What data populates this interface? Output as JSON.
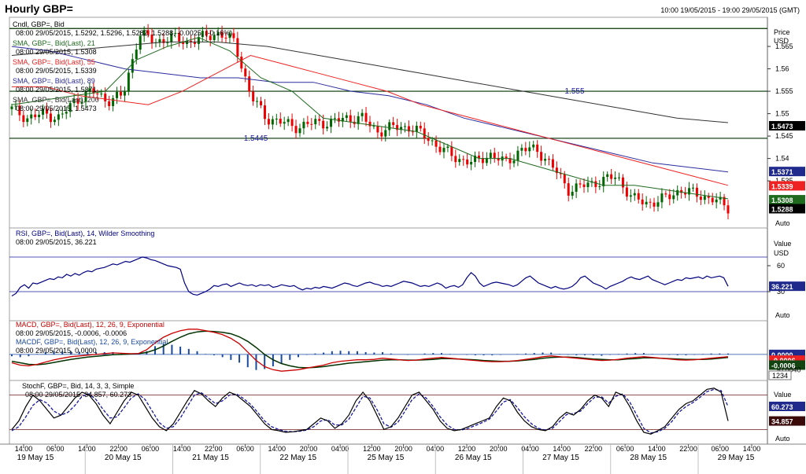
{
  "header": {
    "title": "Hourly GBP=",
    "range": "10:00 19/05/2015 - 19:00 29/05/2015 (GMT)"
  },
  "colors": {
    "up": "#006600",
    "down": "#ee0000",
    "sma21": "#1e6b1e",
    "sma55": "#ee2222",
    "sma89": "#2b2b9e",
    "sma200": "#333333",
    "level": "#003300",
    "rsi": "#000080",
    "macd": "#cc0000",
    "macdSignal": "#003300",
    "hist": "#1a4aa0",
    "stochK": "#000000",
    "stochD": "#1a1aa0",
    "stochRef": "#6b1a1a"
  },
  "xaxis": {
    "hours": [
      "14:00",
      "06:00",
      "14:00",
      "22:00",
      "06:00",
      "14:00",
      "22:00",
      "06:00",
      "14:00",
      "20:00",
      "04:00",
      "12:00",
      "20:00",
      "04:00",
      "12:00",
      "20:00",
      "04:00",
      "14:00",
      "22:00",
      "06:00",
      "14:00",
      "22:00",
      "06:00",
      "14:00"
    ],
    "days": [
      "19 May 15",
      "20 May 15",
      "21 May 15",
      "22 May 15",
      "25 May 15",
      "26 May 15",
      "27 May 15",
      "28 May 15",
      "29 May 15"
    ]
  },
  "chart_data": [
    {
      "type": "candlestick",
      "panel": "price",
      "ylim": [
        1.5245,
        1.5715
      ],
      "yticks": [
        "1.565",
        "1.56",
        "1.555",
        "1.55",
        "1.545",
        "1.54",
        "1.535"
      ],
      "ylabel": "Price",
      "unit": "USD",
      "auto_label": "Auto",
      "legend": [
        {
          "label": "Cndl, GBP=, Bid",
          "info": "08:00 29/05/2015, 1.5292, 1.5296, 1.5282, 1.5288, -0.0025, (-0.16%)",
          "color": "#000000"
        },
        {
          "label": "SMA, GBP=, Bid(Last), 21",
          "info": "08:00 29/05/2015, 1.5308",
          "color": "#1e6b1e"
        },
        {
          "label": "SMA, GBP=, Bid(Last), 55",
          "info": "08:00 29/05/2015, 1.5339",
          "color": "#ee2222"
        },
        {
          "label": "SMA, GBP=, Bid(Last), 89",
          "info": "08:00 29/05/2015, 1.5371",
          "color": "#2b2b9e"
        },
        {
          "label": "SMA, GBP=, Bid(Last), 200",
          "info": "08:00 29/05/2015, 1.5473",
          "color": "#333333"
        }
      ],
      "levels": [
        {
          "value": 1.569,
          "label": ""
        },
        {
          "value": 1.555,
          "label": "1.555"
        },
        {
          "value": 1.5445,
          "label": "1.5445"
        }
      ],
      "close_path": [
        1.551,
        1.549,
        1.55,
        1.549,
        1.553,
        1.555,
        1.553,
        1.554,
        1.568,
        1.566,
        1.567,
        1.566,
        1.567,
        1.568,
        1.566,
        1.554,
        1.549,
        1.548,
        1.547,
        1.548,
        1.548,
        1.549,
        1.549,
        1.546,
        1.547,
        1.547,
        1.545,
        1.542,
        1.54,
        1.539,
        1.541,
        1.539,
        1.542,
        1.542,
        1.538,
        1.533,
        1.534,
        1.535,
        1.536,
        1.531,
        1.53,
        1.531,
        1.533,
        1.532,
        1.531,
        1.529
      ],
      "sma21": [
        1.552,
        1.553,
        1.554,
        1.555,
        1.562,
        1.565,
        1.567,
        1.564,
        1.558,
        1.555,
        1.549,
        1.548,
        1.547,
        1.546,
        1.543,
        1.54,
        1.54,
        1.538,
        1.536,
        1.534,
        1.534,
        1.533,
        1.532,
        1.531
      ],
      "sma55": [
        1.556,
        1.556,
        1.554,
        1.553,
        1.552,
        1.555,
        1.559,
        1.563,
        1.561,
        1.559,
        1.557,
        1.555,
        1.552,
        1.55,
        1.548,
        1.546,
        1.544,
        1.542,
        1.54,
        1.538,
        1.536,
        1.534
      ],
      "sma89": [
        1.565,
        1.564,
        1.562,
        1.56,
        1.559,
        1.558,
        1.558,
        1.557,
        1.557,
        1.555,
        1.554,
        1.552,
        1.549,
        1.547,
        1.545,
        1.543,
        1.541,
        1.539,
        1.538,
        1.537
      ],
      "sma200": [
        1.563,
        1.564,
        1.565,
        1.566,
        1.566,
        1.565,
        1.563,
        1.561,
        1.559,
        1.557,
        1.555,
        1.553,
        1.551,
        1.549,
        1.548
      ],
      "badges": [
        {
          "value": "1.5473",
          "bg": "#000000",
          "fg": "#ffffff",
          "y": 1.5473
        },
        {
          "value": "1.5371",
          "bg": "#1f2a8c",
          "fg": "#ffffff",
          "y": 1.5371
        },
        {
          "value": "1.5339",
          "bg": "#ee2222",
          "fg": "#ffffff",
          "y": 1.5339
        },
        {
          "value": "1.5308",
          "bg": "#1e6b1e",
          "fg": "#ffffff",
          "y": 1.5308
        },
        {
          "value": "1.5288",
          "bg": "#000000",
          "fg": "#ffffff",
          "y": 1.5288
        }
      ]
    },
    {
      "type": "line",
      "panel": "rsi",
      "legend": [
        {
          "label": "RSI, GBP=, Bid(Last),  14, Wilder Smoothing",
          "info": "08:00 29/05/2015, 36.221",
          "color": "#000080"
        }
      ],
      "ylabel": "Value",
      "unit": "USD",
      "auto_label": "Auto",
      "yticks": [
        "60",
        "30"
      ],
      "levels": [
        70,
        30
      ],
      "ylim": [
        0,
        100
      ],
      "values": [
        25,
        28,
        35,
        38,
        34,
        40,
        39,
        41,
        43,
        45,
        44,
        47,
        46,
        50,
        48,
        51,
        49,
        52,
        54,
        53,
        56,
        57,
        58,
        60,
        62,
        61,
        63,
        65,
        64,
        66,
        68,
        70,
        69,
        67,
        66,
        64,
        62,
        60,
        59,
        58,
        56,
        40,
        30,
        27,
        26,
        28,
        30,
        33,
        37,
        36,
        38,
        39,
        36,
        38,
        40,
        38,
        37,
        38,
        36,
        38,
        37,
        38,
        35,
        36,
        38,
        37,
        36,
        37,
        34,
        32,
        34,
        33,
        35,
        34,
        36,
        35,
        34,
        36,
        38,
        40,
        39,
        37,
        36,
        38,
        40,
        41,
        39,
        38,
        36,
        37,
        36,
        38,
        40,
        42,
        41,
        40,
        38,
        36,
        37,
        36,
        38,
        40,
        38,
        34,
        36,
        37,
        35,
        38,
        46,
        52,
        48,
        40,
        36,
        38,
        40,
        41,
        40,
        39,
        38,
        36,
        38,
        42,
        46,
        48,
        44,
        40,
        38,
        36,
        34,
        36,
        34,
        33,
        34,
        36,
        40,
        46,
        48,
        44,
        40,
        38,
        36,
        33,
        36,
        38,
        40,
        42,
        45,
        47,
        45,
        44,
        46,
        48,
        44,
        42,
        40,
        38,
        40,
        42,
        44,
        43,
        46,
        45,
        46,
        47,
        45,
        48,
        46,
        47,
        48,
        46,
        36.2
      ],
      "badge": {
        "value": "36.221",
        "bg": "#1f2a8c",
        "fg": "#ffffff",
        "y": 36.221
      }
    },
    {
      "type": "line",
      "panel": "macd",
      "legend": [
        {
          "label": "MACD, GBP=, Bid(Last),  12, 26, 9, Exponential",
          "info": "08:00 29/05/2015, -0.0006, -0.0006",
          "color": "#cc0000"
        },
        {
          "label": "MACDF, GBP=, Bid(Last),  12, 26, 9, Exponential",
          "info": "08:00 29/05/2015, 0.0000",
          "color": "#1a4aa0"
        }
      ],
      "yticks": [
        "0.0000",
        "-0.0006",
        "-0.0040"
      ],
      "ylim": [
        -0.006,
        0.008
      ],
      "auto_label": "1234",
      "macd": [
        -0.0022,
        -0.0028,
        -0.003,
        -0.0026,
        -0.002,
        -0.0014,
        -0.001,
        -0.0006,
        -0.0004,
        -0.0002,
        0.0,
        0.0002,
        0.0004,
        0.0003,
        0.0002,
        0.0002,
        0.0012,
        0.003,
        0.0045,
        0.0055,
        0.0062,
        0.0066,
        0.0066,
        0.0062,
        0.0058,
        0.0052,
        0.0042,
        0.0028,
        0.0006,
        -0.0016,
        -0.0032,
        -0.004,
        -0.0044,
        -0.0042,
        -0.004,
        -0.0036,
        -0.0032,
        -0.0028,
        -0.0022,
        -0.0018,
        -0.0016,
        -0.0014,
        -0.0014,
        -0.0013,
        -0.001,
        -0.0012,
        -0.0014,
        -0.0016,
        -0.0015,
        -0.0012,
        -0.001,
        -0.0008,
        -0.001,
        -0.0012,
        -0.0014,
        -0.0016,
        -0.0018,
        -0.0019,
        -0.0019,
        -0.0018,
        -0.0016,
        -0.0013,
        -0.001,
        -0.0006,
        -0.0004,
        -0.0006,
        -0.0008,
        -0.001,
        -0.0012,
        -0.0014,
        -0.0016,
        -0.0015,
        -0.0013,
        -0.001,
        -0.0008,
        -0.0006,
        -0.0008,
        -0.001,
        -0.0012,
        -0.0014,
        -0.0015,
        -0.0014,
        -0.0012,
        -0.001,
        -0.0008,
        -0.0006
      ],
      "signal": [
        -0.0018,
        -0.0022,
        -0.0026,
        -0.0027,
        -0.0025,
        -0.0021,
        -0.0017,
        -0.0013,
        -0.001,
        -0.0007,
        -0.0005,
        -0.0003,
        -0.0001,
        0.0,
        0.0001,
        0.0002,
        0.0005,
        0.0012,
        0.0022,
        0.0034,
        0.0045,
        0.0054,
        0.0059,
        0.0061,
        0.006,
        0.0058,
        0.0054,
        0.0046,
        0.0034,
        0.0018,
        0.0,
        -0.0014,
        -0.0024,
        -0.003,
        -0.0034,
        -0.0035,
        -0.0034,
        -0.0032,
        -0.0029,
        -0.0026,
        -0.0023,
        -0.0021,
        -0.0019,
        -0.0017,
        -0.0015,
        -0.0014,
        -0.0014,
        -0.0015,
        -0.0015,
        -0.0014,
        -0.0013,
        -0.0011,
        -0.0011,
        -0.0012,
        -0.0013,
        -0.0014,
        -0.0016,
        -0.0017,
        -0.0018,
        -0.0018,
        -0.0017,
        -0.0015,
        -0.0013,
        -0.001,
        -0.0008,
        -0.0007,
        -0.0007,
        -0.0008,
        -0.001,
        -0.0012,
        -0.0013,
        -0.0014,
        -0.0014,
        -0.0012,
        -0.0011,
        -0.0009,
        -0.0009,
        -0.001,
        -0.0011,
        -0.0012,
        -0.0013,
        -0.0013,
        -0.0013,
        -0.0012,
        -0.001,
        -0.0008
      ],
      "badges": [
        {
          "value": "0.0000",
          "bg": "#1f2a8c",
          "fg": "#ffffff",
          "y": 0.0
        },
        {
          "value": "-0.0006",
          "bg": "#ee2222",
          "fg": "#ffffff",
          "y": -0.0015
        },
        {
          "value": "-0.0006",
          "bg": "#114411",
          "fg": "#ffffff",
          "y": -0.0028
        }
      ]
    },
    {
      "type": "line",
      "panel": "stoch",
      "legend": [
        {
          "label": "StochF, GBP=, Bid,  14, 3, 3, Simple",
          "info": "08:00 29/05/2015, 34.857, 60.273",
          "color": "#000000"
        }
      ],
      "ylabel": "Value",
      "auto_label": "Auto",
      "ylim": [
        0,
        100
      ],
      "levels": [
        80,
        20
      ],
      "k": [
        20,
        35,
        60,
        80,
        70,
        55,
        40,
        45,
        60,
        75,
        85,
        80,
        65,
        45,
        30,
        50,
        70,
        85,
        80,
        60,
        40,
        25,
        18,
        30,
        50,
        70,
        88,
        82,
        70,
        60,
        75,
        85,
        80,
        70,
        60,
        45,
        30,
        20,
        18,
        15,
        16,
        18,
        20,
        30,
        40,
        35,
        22,
        30,
        45,
        70,
        85,
        70,
        45,
        20,
        25,
        40,
        60,
        80,
        85,
        70,
        55,
        35,
        22,
        18,
        20,
        25,
        30,
        35,
        40,
        60,
        75,
        70,
        50,
        35,
        25,
        20,
        18,
        25,
        40,
        50,
        45,
        55,
        70,
        80,
        75,
        60,
        85,
        80,
        60,
        35,
        15,
        12,
        18,
        25,
        40,
        55,
        65,
        70,
        80,
        90,
        92,
        85,
        35
      ],
      "d": [
        18,
        25,
        42,
        62,
        72,
        66,
        52,
        45,
        50,
        62,
        78,
        82,
        72,
        55,
        40,
        42,
        58,
        75,
        82,
        72,
        52,
        32,
        22,
        25,
        40,
        60,
        80,
        84,
        75,
        65,
        70,
        80,
        82,
        74,
        64,
        50,
        35,
        25,
        20,
        17,
        16,
        17,
        19,
        25,
        35,
        37,
        28,
        28,
        38,
        58,
        78,
        75,
        55,
        30,
        24,
        33,
        52,
        72,
        82,
        75,
        60,
        42,
        28,
        20,
        19,
        22,
        27,
        32,
        38,
        52,
        68,
        72,
        58,
        42,
        30,
        22,
        19,
        22,
        34,
        46,
        48,
        52,
        65,
        76,
        77,
        66,
        78,
        82,
        68,
        45,
        22,
        14,
        16,
        22,
        34,
        50,
        60,
        67,
        76,
        86,
        90,
        88,
        60
      ],
      "badges": [
        {
          "value": "60.273",
          "bg": "#1f2a8c",
          "fg": "#ffffff",
          "y": 60.273
        },
        {
          "value": "34.857",
          "bg": "#3a0a0a",
          "fg": "#ffffff",
          "y": 34.857
        }
      ]
    }
  ]
}
